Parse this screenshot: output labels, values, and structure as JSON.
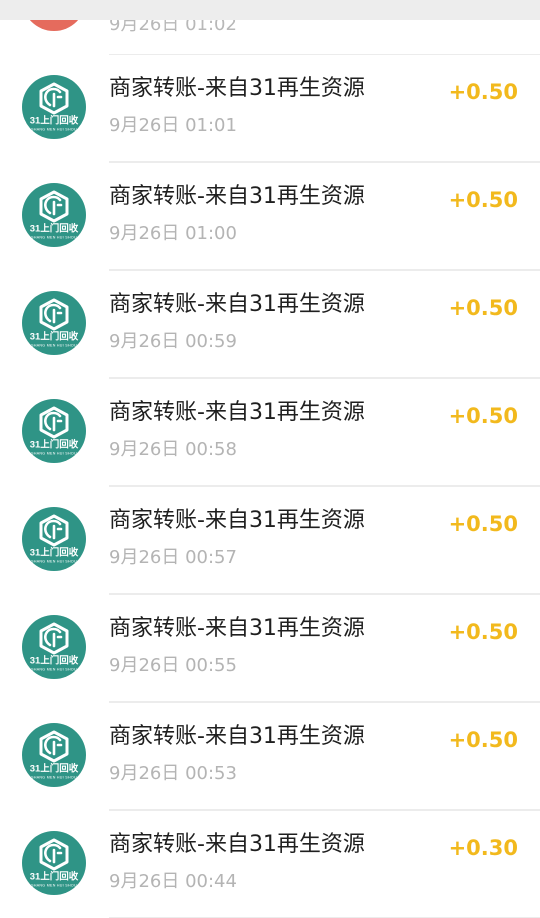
{
  "colors": {
    "amount": "#f2b91d",
    "avatar_bg": "#2f9486",
    "partial_avatar_bg": "#e56b5d",
    "title": "#1f1f1f",
    "time": "#b4b4b4"
  },
  "partial_row": {
    "time": "9月26日 01:02"
  },
  "avatar_logo": {
    "icon": "recycling-logo-icon",
    "brand": "31上门回收",
    "sub": "SHANG MEN HUI SHOU"
  },
  "transactions": [
    {
      "title": "商家转账-来自31再生资源",
      "time": "9月26日 01:01",
      "amount": "+0.50"
    },
    {
      "title": "商家转账-来自31再生资源",
      "time": "9月26日 01:00",
      "amount": "+0.50"
    },
    {
      "title": "商家转账-来自31再生资源",
      "time": "9月26日 00:59",
      "amount": "+0.50"
    },
    {
      "title": "商家转账-来自31再生资源",
      "time": "9月26日 00:58",
      "amount": "+0.50"
    },
    {
      "title": "商家转账-来自31再生资源",
      "time": "9月26日 00:57",
      "amount": "+0.50"
    },
    {
      "title": "商家转账-来自31再生资源",
      "time": "9月26日 00:55",
      "amount": "+0.50"
    },
    {
      "title": "商家转账-来自31再生资源",
      "time": "9月26日 00:53",
      "amount": "+0.50"
    },
    {
      "title": "商家转账-来自31再生资源",
      "time": "9月26日 00:44",
      "amount": "+0.30"
    }
  ]
}
